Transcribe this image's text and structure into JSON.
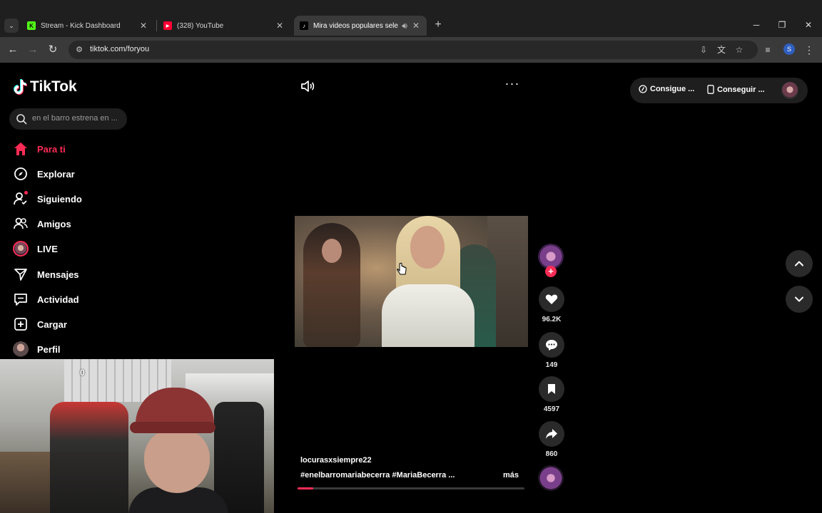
{
  "browser": {
    "tabs": [
      {
        "title": "Stream - Kick Dashboard",
        "favicon": "K",
        "favicon_color": "#53fc18"
      },
      {
        "title": "(328) YouTube",
        "favicon": "▶",
        "favicon_color": "#ff0033"
      },
      {
        "title": "Mira videos populares seleccionados para ti",
        "favicon": "♪",
        "favicon_color": "#ffffff",
        "active": true
      }
    ],
    "address": {
      "url": "tiktok.com/foryou"
    },
    "profile_initial": "S"
  },
  "tiktok": {
    "logo_text": "TikTok",
    "search_placeholder": "en el barro estrena en ...",
    "nav": [
      {
        "label": "Para ti",
        "icon": "home-icon",
        "active": true
      },
      {
        "label": "Explorar",
        "icon": "compass-icon"
      },
      {
        "label": "Siguiendo",
        "icon": "following-icon"
      },
      {
        "label": "Amigos",
        "icon": "friends-icon"
      },
      {
        "label": "LIVE",
        "icon": "live-avatar-icon"
      },
      {
        "label": "Mensajes",
        "icon": "messages-icon"
      },
      {
        "label": "Actividad",
        "icon": "activity-icon"
      },
      {
        "label": "Cargar",
        "icon": "upload-icon"
      },
      {
        "label": "Perfil",
        "icon": "profile-avatar-icon"
      }
    ],
    "top_right": {
      "coins_label": "Consigue ...",
      "app_label": "Conseguir ..."
    },
    "video": {
      "author": "locurasxsiempre22",
      "hashtags": "#enelbarromariabecerra  #MariaBecerra  ...",
      "more_label": "más",
      "progress": 0.07
    },
    "actions": {
      "likes": "96.2K",
      "comments": "149",
      "saves": "4597",
      "shares": "860"
    },
    "accent_color": "#fe2c55"
  },
  "overlay": {
    "webcam_counter": "0"
  }
}
